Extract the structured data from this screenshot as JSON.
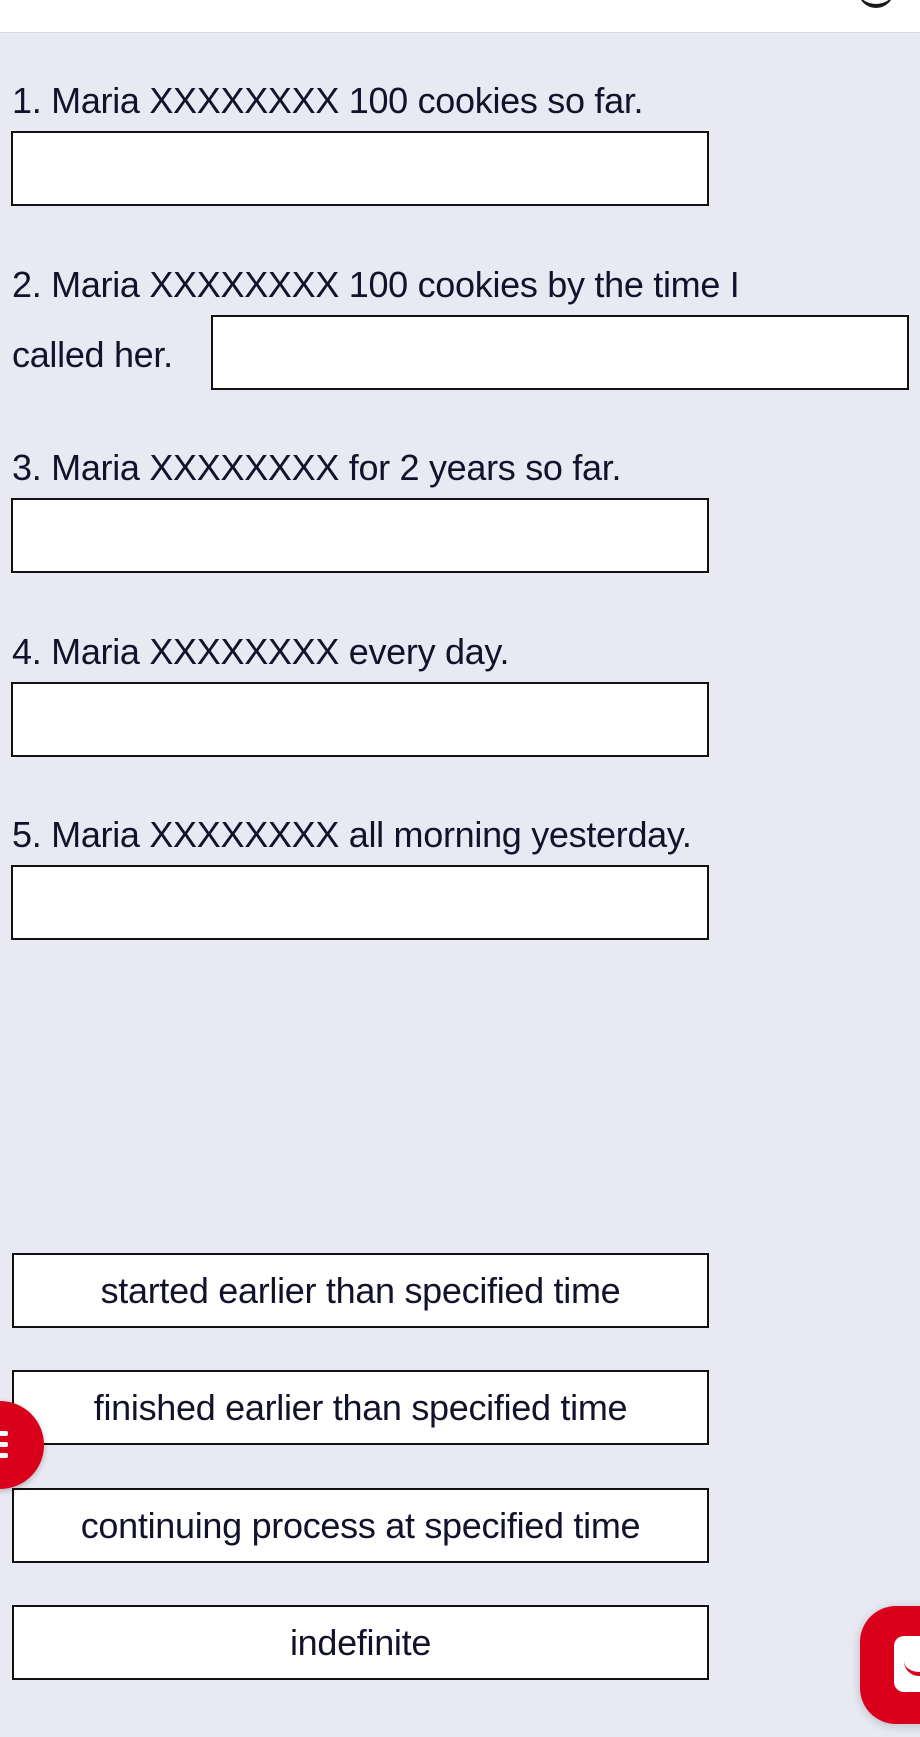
{
  "header": {
    "icon": "partial-round-icon"
  },
  "questions": [
    {
      "number": "1.",
      "text": "1. Maria XXXXXXXX 100 cookies so far.",
      "answer": ""
    },
    {
      "number": "2.",
      "text_line1": "2. Maria XXXXXXXX 100 cookies by the time I",
      "text_line2": "called her.",
      "answer": ""
    },
    {
      "number": "3.",
      "text": "3. Maria XXXXXXXX for 2 years so far.",
      "answer": ""
    },
    {
      "number": "4.",
      "text": "4. Maria XXXXXXXX every day.",
      "answer": ""
    },
    {
      "number": "5.",
      "text": "5. Maria XXXXXXXX all morning yesterday.",
      "answer": ""
    }
  ],
  "answer_options": [
    {
      "label": "started earlier than specified time"
    },
    {
      "label": "finished earlier than specified time"
    },
    {
      "label": "continuing process at specified time"
    },
    {
      "label": "indefinite"
    }
  ],
  "floating": {
    "menu_button": {
      "icon": "menu-icon"
    },
    "chat_button": {
      "icon": "chat-smile-icon"
    }
  },
  "colors": {
    "background": "#e9e9f3",
    "accent": "#d9001b",
    "text": "#12122a",
    "border": "#111111"
  }
}
